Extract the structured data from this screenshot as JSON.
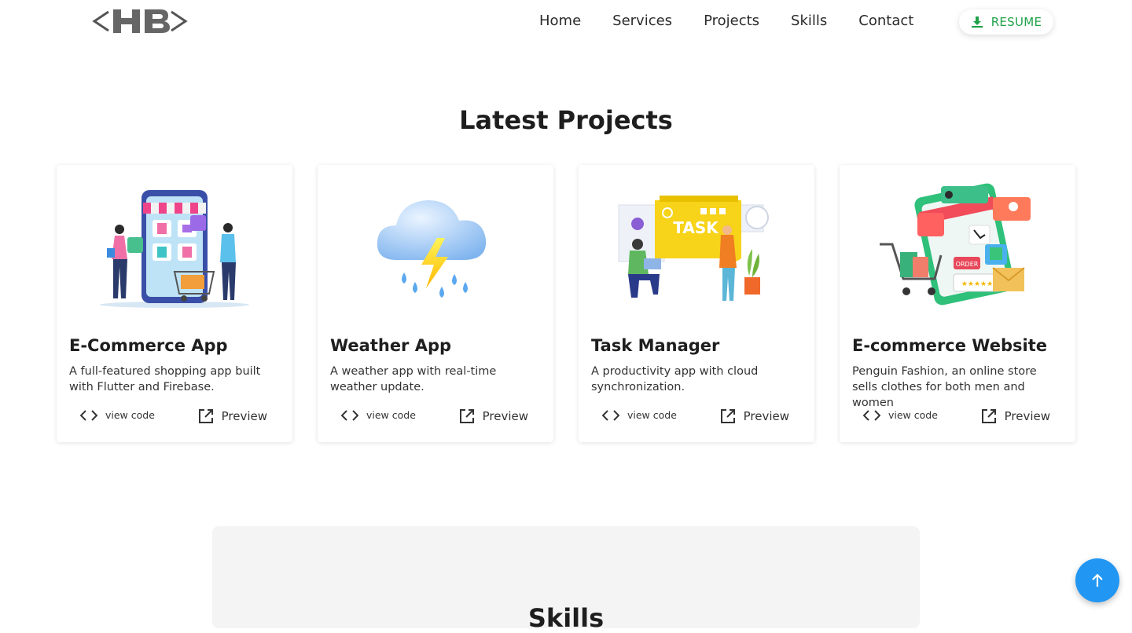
{
  "nav": {
    "logo_text": "<HB>",
    "links": [
      "Home",
      "Services",
      "Projects",
      "Skills",
      "Contact"
    ],
    "resume_label": "RESUME"
  },
  "projects": {
    "title": "Latest Projects",
    "items": [
      {
        "title": "E-Commerce App",
        "description": "A full-featured shopping app built with Flutter and Firebase.",
        "code_label": "view code",
        "preview_label": "Preview",
        "image_icon": "shopping-illustration"
      },
      {
        "title": "Weather App",
        "description": "A weather app with real-time weather update.",
        "code_label": "view code",
        "preview_label": "Preview",
        "image_icon": "storm-cloud-illustration"
      },
      {
        "title": "Task Manager",
        "description": "A productivity app with cloud synchronization.",
        "code_label": "view code",
        "preview_label": "Preview",
        "image_icon": "task-board-illustration"
      },
      {
        "title": "E-commerce Website",
        "description": "Penguin Fashion, an online store sells clothes for both men and women",
        "code_label": "view code",
        "preview_label": "Preview",
        "image_icon": "online-store-illustration"
      }
    ]
  },
  "skills": {
    "title": "Skills"
  },
  "colors": {
    "accent": "#1fa24a",
    "scroll_button": "#2196f3"
  }
}
